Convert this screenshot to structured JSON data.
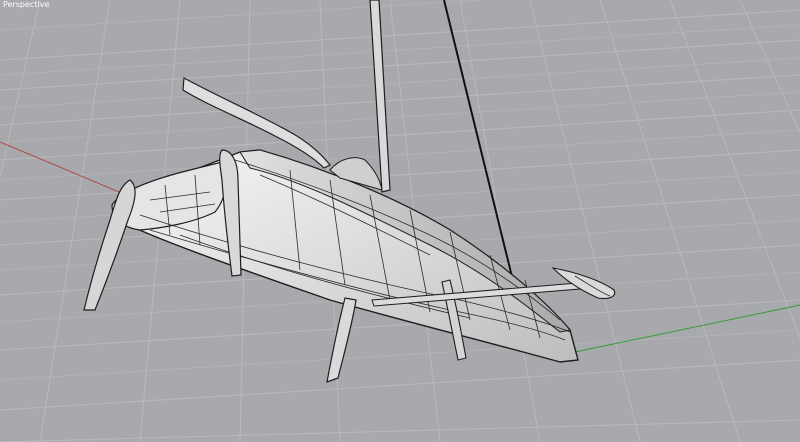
{
  "viewport": {
    "title": "Perspective",
    "background_color": "#a7a9ac",
    "grid_color": "#b7b9bc",
    "x_axis_color": "#b34545",
    "y_axis_color": "#3a9a3a"
  },
  "model": {
    "hull_color": "#e8e8e8",
    "outline_color": "#1e1e1e"
  }
}
